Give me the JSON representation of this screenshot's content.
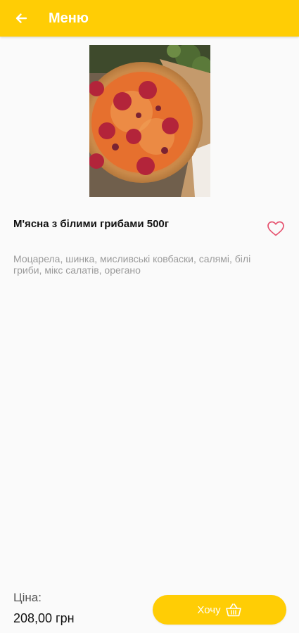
{
  "app_bar": {
    "title": "Меню",
    "back_icon": "arrow-back-icon",
    "background": "#ffcd05"
  },
  "product": {
    "image": "pizza-photo",
    "title": "М'ясна з білими грибами 500г",
    "description": "Моцарела, шинка, мисливські ковбаски, салямі, білі гриби, мікс салатів, орегано",
    "favorite_icon": "heart-outline-icon",
    "favorite_color": "#e6516e"
  },
  "footer": {
    "price_label": "Ціна:",
    "price_value": "208,00 грн",
    "want_button_label": "Хочу",
    "basket_icon": "basket-icon",
    "button_color": "#ffcd05"
  }
}
